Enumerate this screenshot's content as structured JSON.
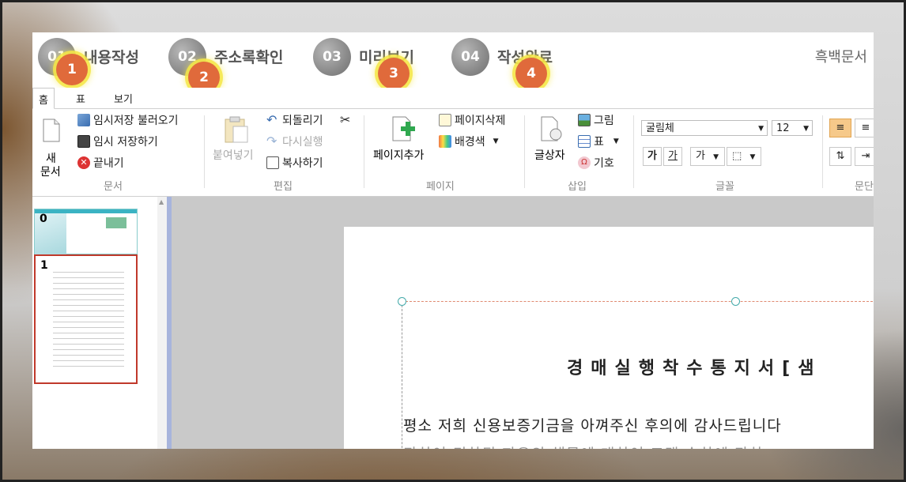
{
  "steps": [
    {
      "num": "01",
      "label": "내용작성",
      "badge": "1"
    },
    {
      "num": "02",
      "label": "주소록확인",
      "badge": "2"
    },
    {
      "num": "03",
      "label": "미리보기",
      "badge": "3"
    },
    {
      "num": "04",
      "label": "작성완료",
      "badge": "4"
    }
  ],
  "mode_label": "흑백문서",
  "tabs": [
    "홈",
    "표",
    "보기"
  ],
  "ribbon": {
    "document": {
      "new_label_1": "새",
      "new_label_2": "문서",
      "load_temp": "임시저장 불러오기",
      "save_temp": "임시 저장하기",
      "exit": "끝내기",
      "group": "문서"
    },
    "edit": {
      "paste": "붙여넣기",
      "undo": "되돌리기",
      "redo": "다시실행",
      "copy": "복사하기",
      "group": "편집"
    },
    "page": {
      "add": "페이지추가",
      "delete": "페이지삭제",
      "background": "배경색",
      "group": "페이지"
    },
    "insert": {
      "textbox": "글상자",
      "image": "그림",
      "table": "표",
      "symbol": "기호",
      "group": "삽입"
    },
    "font": {
      "face": "굴림체",
      "size": "12",
      "bold": "가",
      "underline": "가",
      "color": "가",
      "group": "글꼴"
    },
    "paragraph": {
      "group": "문단"
    }
  },
  "thumbnails": [
    "0",
    "1"
  ],
  "document": {
    "title": "경매실행착수통지서[샘",
    "line1": "평소 저희 신용보증기금을 아껴주신 후의에 감사드립니다",
    "line2": "관하여 귀하된 자유의 해목에 대하여 고객 승하에 관하"
  },
  "colors": {
    "step_circle": "#8a8a8a",
    "badge": "#e06a3b",
    "badge_glow": "#f5e646",
    "splitter": "#a7b4dc",
    "thumb_selected_border": "#c0392b"
  }
}
